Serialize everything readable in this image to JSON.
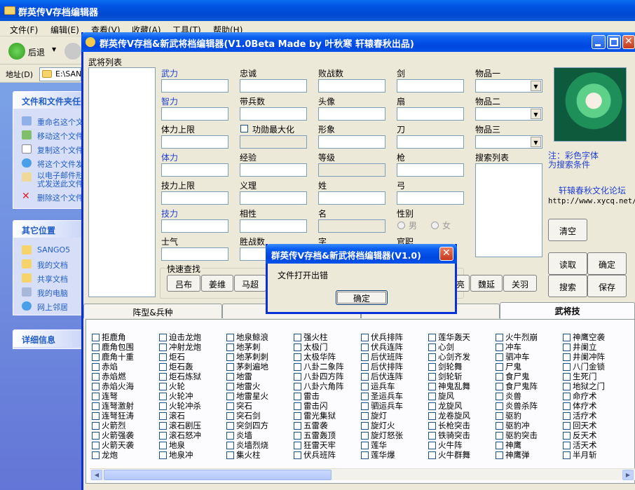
{
  "explorer": {
    "title": "群英传V存档编辑器",
    "menu": [
      "文件(F)",
      "编辑(E)",
      "查看(V)",
      "收藏(A)",
      "工具(T)",
      "帮助(H)"
    ],
    "back_label": "后退",
    "address_label": "地址(D)",
    "address_value": "E:\\SAN",
    "tasks_title": "文件和文件夹任务",
    "tasks": [
      "重命名这个文件",
      "移动这个文件",
      "复制这个文件",
      "将这个文件发布到",
      "以电子邮件形式发送此文件",
      "删除这个文件"
    ],
    "places_title": "其它位置",
    "places": [
      "SANGO5",
      "我的文档",
      "共享文档",
      "我的电脑",
      "网上邻居"
    ],
    "details_title": "详细信息"
  },
  "editor": {
    "title": "群英传V存档&新武将档编辑器(V1.0Beta Made by 叶秋寒  轩辕春秋出品)",
    "list_label": "武将列表",
    "fields": {
      "wuli": "武力",
      "zhongcheng": "忠诚",
      "baizhan": "败战数",
      "jian": "剑",
      "wupin1": "物品一",
      "zhili": "智力",
      "daibing": "带兵数",
      "touxiang": "头像",
      "shan": "扇",
      "wupin2": "物品二",
      "tili_max": "体力上限",
      "gongdong_max": "功勋最大化",
      "xingxiang": "形象",
      "dao": "刀",
      "wupin3": "物品三",
      "tili": "体力",
      "jingyan": "经验",
      "dengji": "等级",
      "qiang": "枪",
      "search_list": "搜索列表",
      "jili_max": "技力上限",
      "yili": "义理",
      "xing": "姓",
      "gong": "弓",
      "jili": "技力",
      "xiangxing": "相性",
      "ming": "名",
      "xingbie": "性别",
      "male": "男",
      "female": "女",
      "shiqi": "士气",
      "shengzhan": "胜战数",
      "zi": "字",
      "guanzhi": "官职"
    },
    "note": "注：彩色字体\n为搜索条件",
    "forum_name": "轩辕春秋文化论坛",
    "forum_url": "http://www.xycq.net/",
    "buttons": {
      "clear": "清空",
      "read": "读取",
      "confirm": "确定",
      "search": "搜索",
      "save": "保存"
    },
    "quick_search_label": "快速查找",
    "quick_search": [
      "吕布",
      "姜维",
      "马超",
      "亮",
      "魏延",
      "关羽"
    ],
    "tabs": [
      "阵型&兵种",
      "",
      "",
      "武将技"
    ],
    "skills": [
      [
        "拒鹿角",
        "鹿角包围",
        "鹿角十重",
        "赤焰",
        "赤焰燃",
        "赤焰火海",
        "连弩",
        "连弩激射",
        "连弩狂涛",
        "火箭烈",
        "火箭强袭",
        "火箭天袭",
        "龙炮"
      ],
      [
        "迫击龙炮",
        "冲射龙炮",
        "炬石",
        "炬石轰",
        "炬石炼狱",
        "火轮",
        "火轮冲",
        "火轮冲杀",
        "滚石",
        "滚石剧压",
        "滚石怒冲",
        "地泉",
        "地泉冲"
      ],
      [
        "地泉鲸浪",
        "地茅刺",
        "地茅刺刺",
        "茅刺遍地",
        "地雷",
        "地雷火",
        "地雷星火",
        "突石",
        "突石剑",
        "突剑四方",
        "炎墙",
        "炎墙烈烧",
        "集火柱"
      ],
      [
        "强火柱",
        "太极门",
        "太极华阵",
        "八卦二象阵",
        "八卦四方阵",
        "八卦六角阵",
        "雷击",
        "雷击闪",
        "雷光集狱",
        "五雷袭",
        "五雷轰顶",
        "狂雷天牢",
        "伏兵班阵"
      ],
      [
        "伏兵排阵",
        "伏兵连阵",
        "后伏班阵",
        "后伏排阵",
        "后伏连阵",
        "运兵车",
        "圣运兵车",
        "驷运兵车",
        "旋灯",
        "旋灯火",
        "旋灯怒张",
        "莲华",
        "莲华爆"
      ],
      [
        "莲华轰天",
        "心剑",
        "心剑齐发",
        "剑轮舞",
        "剑轮斩",
        "神鬼乱舞",
        "旋风",
        "龙旋风",
        "龙卷旋风",
        "长枪突击",
        "铁骑突击",
        "火牛阵",
        "火牛群舞"
      ],
      [
        "火牛烈崩",
        "冲车",
        "驷冲车",
        "尸鬼",
        "食尸鬼",
        "食尸鬼阵",
        "炎兽",
        "炎兽杀阵",
        "驱豹",
        "驱豹冲",
        "驱豹突击",
        "神鹰",
        "神鹰弹"
      ],
      [
        "神鹰空袭",
        "井阑立",
        "井阑冲阵",
        "八门金锁",
        "生死门",
        "地狱之门",
        "命疗术",
        "体疗术",
        "活疗术",
        "回天术",
        "反天术",
        "活天术",
        "半月斩"
      ]
    ]
  },
  "dialog": {
    "title": "群英传V存档&新武将档编辑器(V1.0)",
    "message": "文件打开出错",
    "ok": "确定"
  }
}
